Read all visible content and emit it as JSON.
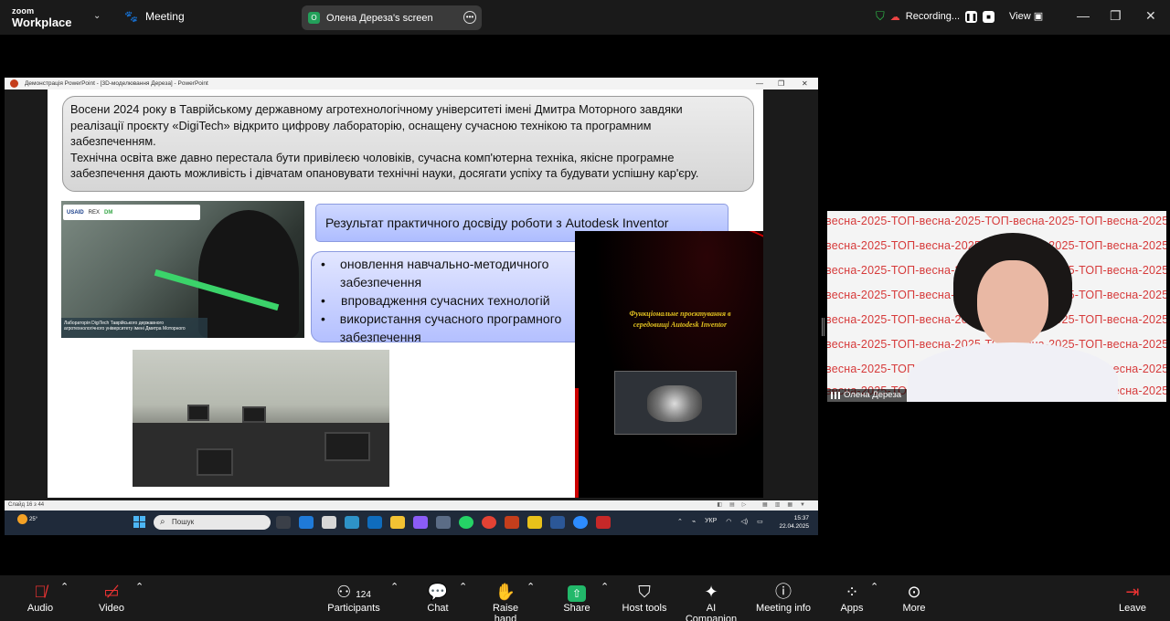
{
  "topbar": {
    "brand_line1": "zoom",
    "brand_line2": "Workplace",
    "meeting_label": "Meeting",
    "share_pill_badge": "O",
    "share_pill_label": "Олена Дереза's screen",
    "recording_label": "Recording...",
    "view_label": "View"
  },
  "powerpoint": {
    "window_title": "Демонстрація PowerPoint - [3D-моделювання Дереза] - PowerPoint",
    "slide_text_lines": [
      "Восени 2024 року в Таврійському державному агротехнологічному університеті імені Дмитра Моторного завдяки",
      "реалізації проєкту «DigiTech» відкрито цифрову лабораторію, оснащену сучасною технікою та програмним",
      "забезпеченням.",
      "Технічна освіта вже давно перестала бути привілеєю чоловіків, сучасна комп'ютерна техніка, якісне програмне",
      "забезпечення дають можливість і дівчатам опановувати технічні науки, досягати успіху та будувати успішну кар'єру."
    ],
    "photo_banner_logos": [
      "USAID",
      "REX",
      "DM"
    ],
    "photo_caption": "Лабораторія DigiTech Таврійського державного агротехнологічного університету імені Дмитра Моторного",
    "result_heading": "Результат практичного досвіду роботи з Autodesk Inventor",
    "bullet_char": "•",
    "bullets": [
      "оновлення навчально-методичного забезпечення",
      "впровадження сучасних технологій",
      "використання сучасного програмного забезпечення"
    ],
    "dark_panel_text": "Функціональне проєктування в середовищі Autodesk Inventor",
    "status_left": "Слайд 16 з 44"
  },
  "taskbar": {
    "weather_temp": "25°",
    "search_placeholder": "Пошук",
    "lang": "УКР",
    "time": "15:37",
    "date": "22.04.2025"
  },
  "participant": {
    "name": "Олена Дереза",
    "watermark_text": "весна-2025-ТОП-весна-2025-ТОП-весна-2025-ТОП-весна-2025-ТОП"
  },
  "toolbar": {
    "audio": "Audio",
    "video": "Video",
    "participants": "Participants",
    "participants_count": "124",
    "chat": "Chat",
    "raise_hand": "Raise hand",
    "share": "Share",
    "host_tools": "Host tools",
    "ai_companion": "AI Companion",
    "meeting_info": "Meeting info",
    "apps": "Apps",
    "more": "More",
    "leave": "Leave"
  }
}
